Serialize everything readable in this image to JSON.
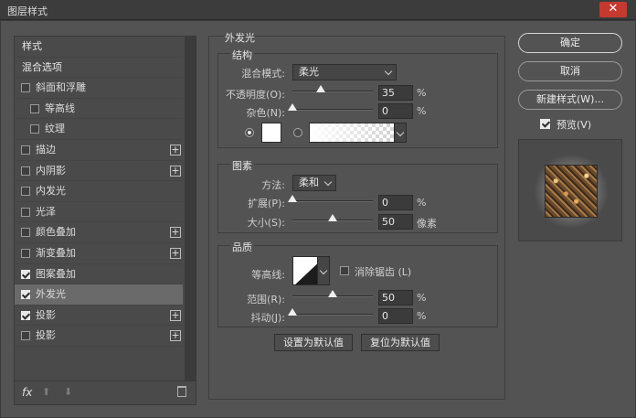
{
  "window": {
    "title": "图层样式",
    "close_label": "✕"
  },
  "left_list": {
    "items": [
      {
        "label": "样式",
        "type": "section"
      },
      {
        "label": "混合选项",
        "type": "section"
      },
      {
        "label": "斜面和浮雕",
        "checked": false,
        "plus": false,
        "sub": false
      },
      {
        "label": "等高线",
        "checked": false,
        "plus": false,
        "sub": true
      },
      {
        "label": "纹理",
        "checked": false,
        "plus": false,
        "sub": true
      },
      {
        "label": "描边",
        "checked": false,
        "plus": true,
        "sub": false
      },
      {
        "label": "内阴影",
        "checked": false,
        "plus": true,
        "sub": false
      },
      {
        "label": "内发光",
        "checked": false,
        "plus": false,
        "sub": false
      },
      {
        "label": "光泽",
        "checked": false,
        "plus": false,
        "sub": false
      },
      {
        "label": "颜色叠加",
        "checked": false,
        "plus": true,
        "sub": false
      },
      {
        "label": "渐变叠加",
        "checked": false,
        "plus": true,
        "sub": false
      },
      {
        "label": "图案叠加",
        "checked": true,
        "plus": false,
        "sub": false
      },
      {
        "label": "外发光",
        "checked": true,
        "plus": false,
        "sub": false,
        "selected": true
      },
      {
        "label": "投影",
        "checked": true,
        "plus": true,
        "sub": false
      },
      {
        "label": "投影",
        "checked": false,
        "plus": true,
        "sub": false
      }
    ],
    "fx_label": "fx"
  },
  "outer_glow": {
    "title": "外发光",
    "structure": {
      "title": "结构",
      "blend_mode_label": "混合模式:",
      "blend_mode_value": "柔光",
      "opacity_label": "不透明度(O):",
      "opacity_value": "35",
      "noise_label": "杂色(N):",
      "noise_value": "0",
      "unit_percent": "%"
    },
    "elements": {
      "title": "图素",
      "technique_label": "方法:",
      "technique_value": "柔和",
      "spread_label": "扩展(P):",
      "spread_value": "0",
      "size_label": "大小(S):",
      "size_value": "50",
      "unit_percent": "%",
      "unit_px": "像素"
    },
    "quality": {
      "title": "品质",
      "contour_label": "等高线:",
      "antialias_label": "消除锯齿 (L)",
      "range_label": "范围(R):",
      "range_value": "50",
      "jitter_label": "抖动(J):",
      "jitter_value": "0",
      "unit_percent": "%"
    },
    "set_default_label": "设置为默认值",
    "reset_default_label": "复位为默认值"
  },
  "actions": {
    "ok_label": "确定",
    "cancel_label": "取消",
    "new_style_label": "新建样式(W)...",
    "preview_label": "预览(V)"
  },
  "sliders": {
    "opacity": 35,
    "noise": 0,
    "spread": 0,
    "size": 50,
    "range": 50,
    "jitter": 0
  },
  "colors": {
    "close_button": "#c43a30",
    "glow_color": "#ffffff"
  }
}
